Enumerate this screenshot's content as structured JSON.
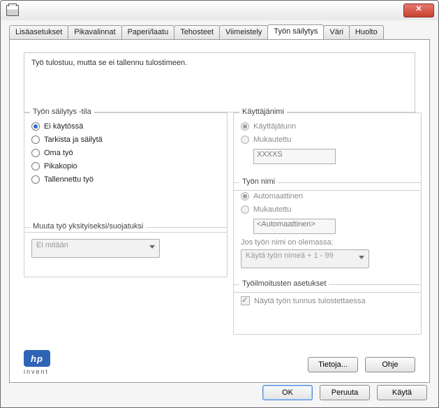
{
  "tabs": [
    "Lisäasetukset",
    "Pikavalinnat",
    "Paperi/laatu",
    "Tehosteet",
    "Viimeistely",
    "Työn säilytys",
    "Väri",
    "Huolto"
  ],
  "active_tab": 5,
  "message": "Työ tulostuu, mutta se ei tallennu tulostimeen.",
  "mode": {
    "legend": "Työn säilytys -tila",
    "options": [
      "Ei käytössä",
      "Tarkista ja säilytä",
      "Oma työ",
      "Pikakopio",
      "Tallennettu työ"
    ],
    "selected": 0
  },
  "privacy": {
    "legend": "Muuta työ yksityiseksi/suojatuksi",
    "value": "Ei mitään"
  },
  "user": {
    "legend": "Käyttäjänimi",
    "option_auto": "Käyttäjätunn",
    "option_custom": "Mukautettu",
    "value": "XXXXS"
  },
  "job": {
    "legend": "Työn nimi",
    "option_auto": "Automaattinen",
    "option_custom": "Mukautettu",
    "value": "<Automaattinen>",
    "exists_hint": "Jos työn nimi on olemassa:",
    "exists_value": "Käytä työn nimeä + 1 - 99"
  },
  "notif": {
    "legend": "Työilmoitusten asetukset",
    "checkbox": "Näytä työn tunnus tulostettaessa"
  },
  "logo_sub": "invent",
  "panel_buttons": {
    "about": "Tietoja...",
    "help": "Ohje"
  },
  "dialog_buttons": {
    "ok": "OK",
    "cancel": "Peruuta",
    "apply": "Käytä"
  }
}
